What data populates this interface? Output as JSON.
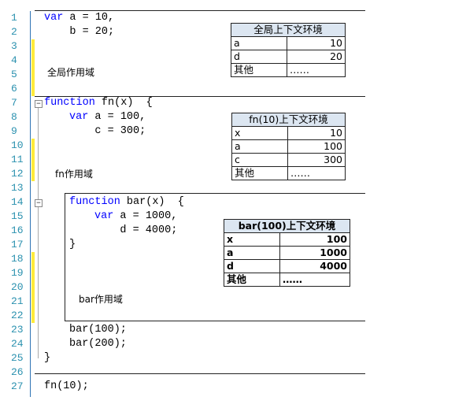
{
  "line_numbers": [
    "1",
    "2",
    "3",
    "4",
    "5",
    "6",
    "7",
    "8",
    "9",
    "10",
    "11",
    "12",
    "13",
    "14",
    "15",
    "16",
    "17",
    "18",
    "19",
    "20",
    "21",
    "22",
    "23",
    "24",
    "25",
    "26",
    "27"
  ],
  "code": {
    "l1_kw": "var",
    "l1_rest": " a = 10,",
    "l2": "    b = 20;",
    "l7_kw": "function",
    "l7_rest": " fn(x)  {",
    "l8_kw": "var",
    "l8_rest": " a = 100,",
    "l9": "    c = 300;",
    "l14_kw": "function",
    "l14_rest": " bar(x)  {",
    "l15_kw": "var",
    "l15_rest": " a = 1000,",
    "l16": "    d = 4000;",
    "l17": "}",
    "l23": "bar(100);",
    "l24": "bar(200);",
    "l25": "}",
    "l27": "fn(10);"
  },
  "regions": {
    "global": "全局作用域",
    "fn": "fn作用域",
    "bar": "bar作用域"
  },
  "tables": {
    "global": {
      "title": "全局上下文环境",
      "rows": [
        [
          "a",
          "10"
        ],
        [
          "d",
          "20"
        ],
        [
          "其他",
          "……"
        ]
      ]
    },
    "fn": {
      "title": "fn(10)上下文环境",
      "rows": [
        [
          "x",
          "10"
        ],
        [
          "a",
          "100"
        ],
        [
          "c",
          "300"
        ],
        [
          "其他",
          "……"
        ]
      ]
    },
    "bar": {
      "title": "bar(100)上下文环境",
      "rows": [
        [
          "x",
          "100"
        ],
        [
          "a",
          "1000"
        ],
        [
          "d",
          "4000"
        ],
        [
          "其他",
          "……"
        ]
      ]
    }
  },
  "colors": {
    "keyword": "#0000ff",
    "line_number": "#2b91af",
    "change_bar": "#ffeb3b",
    "table_header": "#dce6f1"
  }
}
